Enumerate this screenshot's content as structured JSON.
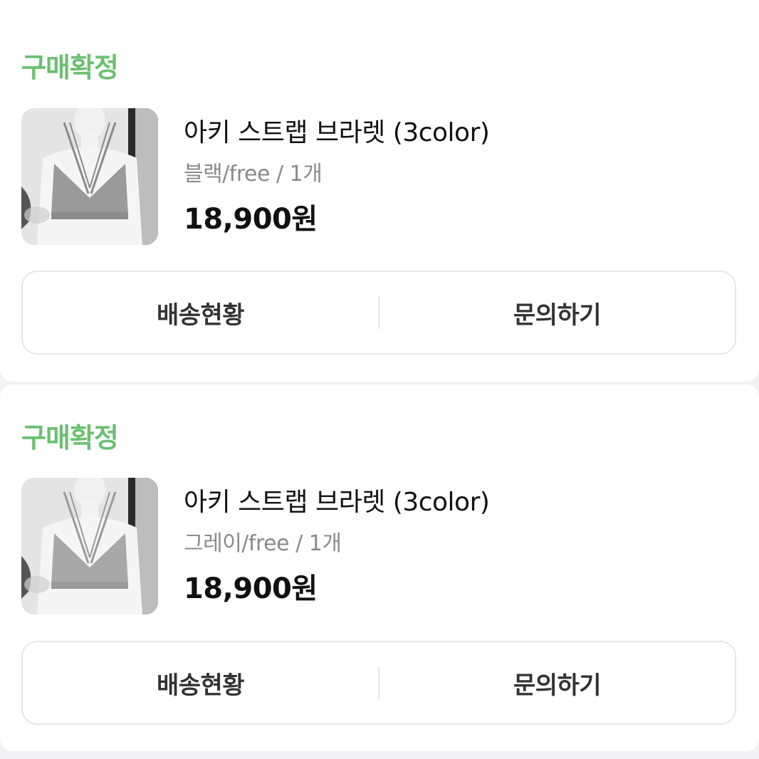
{
  "orders": [
    {
      "status": "구매확정",
      "title": "아키 스트랩 브라렛 (3color)",
      "option": "블랙/free / 1개",
      "price": "18,900원",
      "buttons": {
        "delivery": "배송현황",
        "inquiry": "문의하기"
      }
    },
    {
      "status": "구매확정",
      "title": "아키 스트랩 브라렛 (3color)",
      "option": "그레이/free / 1개",
      "price": "18,900원",
      "buttons": {
        "delivery": "배송현황",
        "inquiry": "문의하기"
      }
    }
  ],
  "colors": {
    "status_green": "#6bc070",
    "price_text": "#111111",
    "option_text": "#8a8a8a",
    "border": "#e6e6e9",
    "background": "#f2f2f4"
  },
  "icons": {
    "thumbnail": "product-photo-mannequin-bralette"
  }
}
